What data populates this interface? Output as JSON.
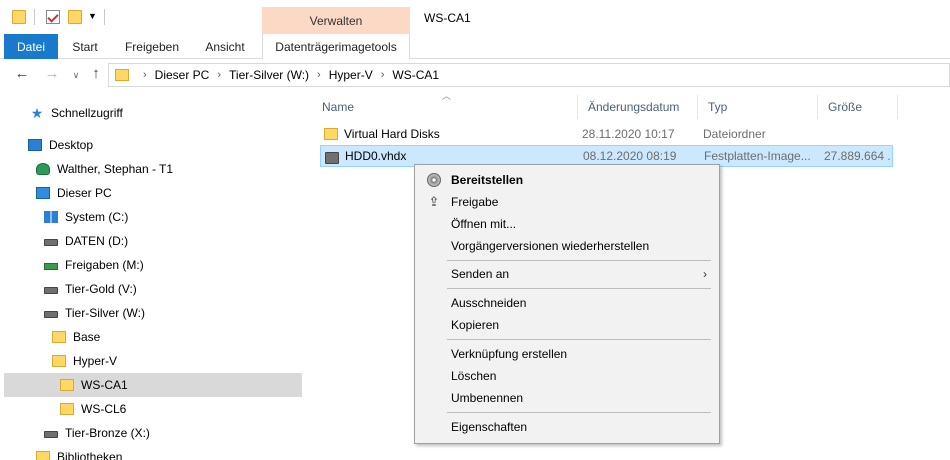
{
  "window": {
    "title": "WS-CA1",
    "context_tab_header": "Verwalten"
  },
  "ribbon": {
    "tabs": [
      {
        "label": "Datei"
      },
      {
        "label": "Start"
      },
      {
        "label": "Freigeben"
      },
      {
        "label": "Ansicht"
      },
      {
        "label": "Datenträgerimagetools"
      }
    ]
  },
  "nav": {
    "breadcrumb": [
      "Dieser PC",
      "Tier-Silver (W:)",
      "Hyper-V",
      "WS-CA1"
    ]
  },
  "sidebar": {
    "items": [
      {
        "label": "Schnellzugriff",
        "icon": "star-icon"
      },
      {
        "label": "Desktop",
        "icon": "desktop-icon"
      },
      {
        "label": "Walther, Stephan - T1",
        "icon": "user-icon"
      },
      {
        "label": "Dieser PC",
        "icon": "computer-icon"
      },
      {
        "label": "System (C:)",
        "icon": "windows-drive-icon"
      },
      {
        "label": "DATEN (D:)",
        "icon": "drive-icon"
      },
      {
        "label": "Freigaben (M:)",
        "icon": "network-drive-icon"
      },
      {
        "label": "Tier-Gold (V:)",
        "icon": "drive-icon"
      },
      {
        "label": "Tier-Silver (W:)",
        "icon": "drive-icon"
      },
      {
        "label": "Base",
        "icon": "folder-icon"
      },
      {
        "label": "Hyper-V",
        "icon": "folder-icon"
      },
      {
        "label": "WS-CA1",
        "icon": "folder-icon",
        "selected": true
      },
      {
        "label": "WS-CL6",
        "icon": "folder-icon"
      },
      {
        "label": "Tier-Bronze (X:)",
        "icon": "drive-icon"
      },
      {
        "label": "Bibliotheken",
        "icon": "libraries-icon"
      }
    ]
  },
  "columns": {
    "name": "Name",
    "date": "Änderungsdatum",
    "type": "Typ",
    "size": "Größe"
  },
  "files": [
    {
      "name": "Virtual Hard Disks",
      "date": "28.11.2020 10:17",
      "type": "Dateiordner",
      "size": "",
      "icon": "folder-icon"
    },
    {
      "name": "HDD0.vhdx",
      "date": "08.12.2020 08:19",
      "type": "Festplatten-Image...",
      "size": "27.889.664 ...",
      "icon": "drive-icon",
      "selected": true
    }
  ],
  "context_menu": {
    "items": [
      {
        "label": "Bereitstellen",
        "default": true,
        "icon": "disc-icon"
      },
      {
        "label": "Freigabe",
        "icon": "share-icon"
      },
      {
        "label": "Öffnen mit..."
      },
      {
        "label": "Vorgängerversionen wiederherstellen"
      },
      {
        "label": "Senden an",
        "submenu": true
      },
      {
        "label": "Ausschneiden"
      },
      {
        "label": "Kopieren"
      },
      {
        "label": "Verknüpfung erstellen"
      },
      {
        "label": "Löschen"
      },
      {
        "label": "Umbenennen"
      },
      {
        "label": "Eigenschaften"
      }
    ]
  },
  "colors": {
    "accent": "#1979ca",
    "context_tab": "#fcd9c5",
    "selection": "#cce8ff",
    "sidebar_selection": "#d9d9d9"
  }
}
